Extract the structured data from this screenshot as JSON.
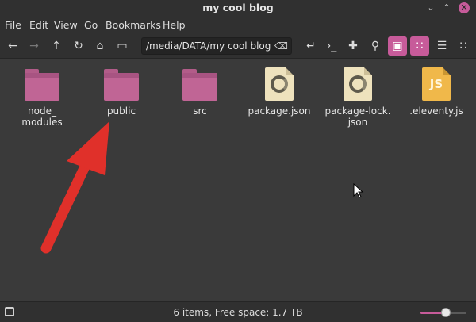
{
  "window": {
    "title": "my cool blog"
  },
  "menu": [
    "File",
    "Edit",
    "View",
    "Go",
    "Bookmarks",
    "Help"
  ],
  "toolbar": {
    "path": "/media/DATA/my cool blog",
    "icons": [
      "back-icon",
      "forward-icon",
      "up-icon",
      "reload-icon",
      "home-icon",
      "computer-icon",
      "open-terminal-icon",
      "terminal-icon",
      "new-folder-icon",
      "search-icon",
      "icon-view-icon",
      "compact-view-icon",
      "list-view-icon",
      "grid-view-icon"
    ]
  },
  "files": [
    {
      "name": "node_\nmodules",
      "type": "folder"
    },
    {
      "name": "public",
      "type": "folder"
    },
    {
      "name": "src",
      "type": "folder"
    },
    {
      "name": "package.json",
      "type": "json"
    },
    {
      "name": "package-lock.\njson",
      "type": "json"
    },
    {
      "name": ".eleventy.js",
      "type": "js",
      "badge": "JS"
    }
  ],
  "status": {
    "text": "6 items, Free space: 1.7 TB",
    "zoom": 0.55
  },
  "colors": {
    "accent": "#c75b9a",
    "folder": "#c06595",
    "arrow": "#e0302a"
  }
}
